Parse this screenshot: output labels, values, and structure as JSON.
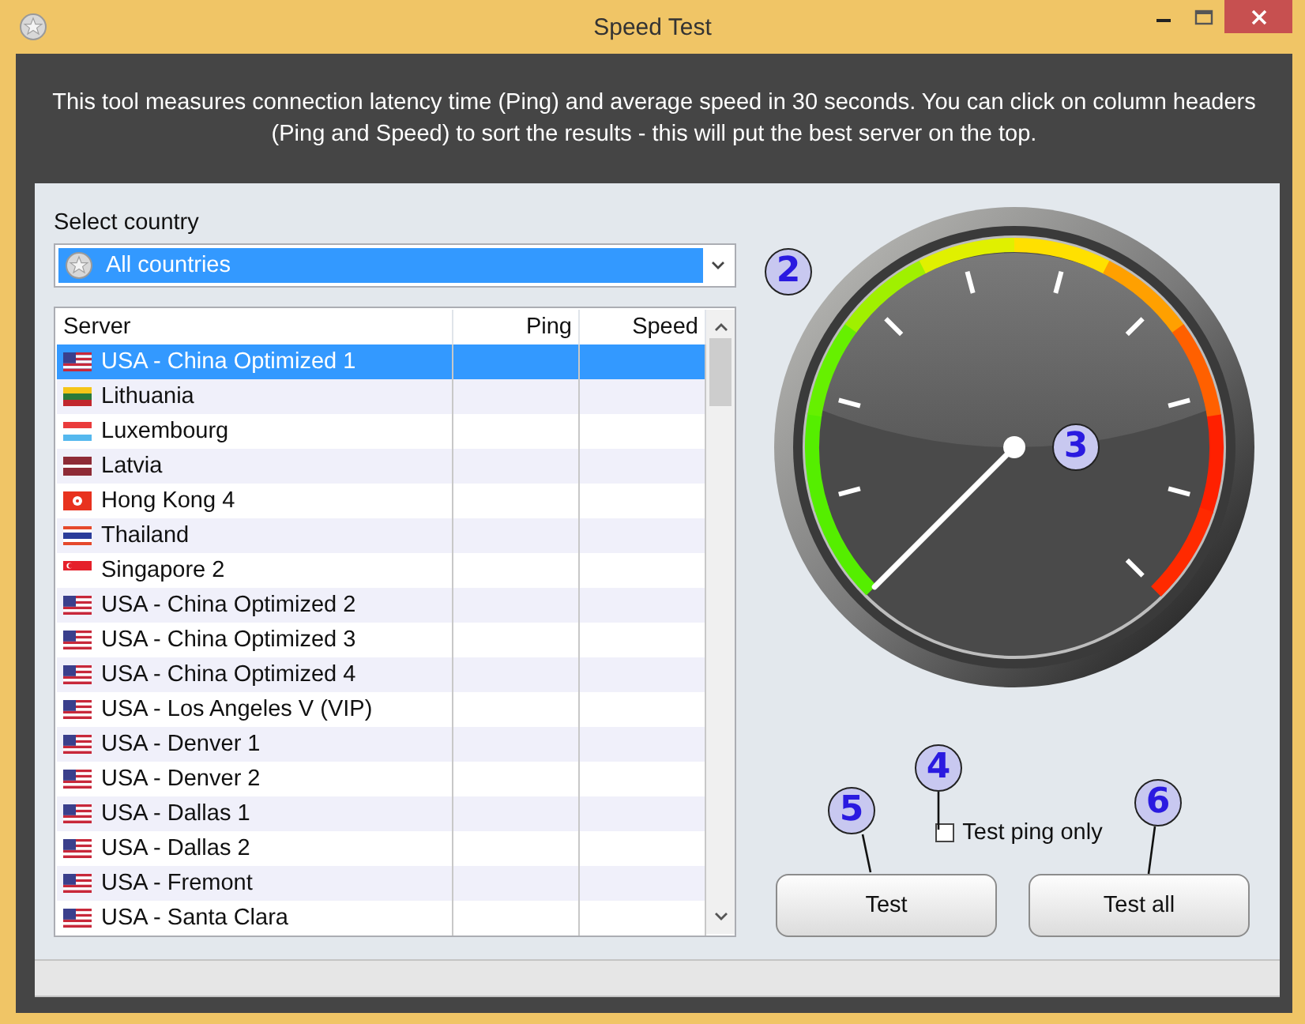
{
  "window": {
    "title": "Speed Test"
  },
  "description": "This tool measures connection latency time (Ping) and average speed in 30 seconds. You can click on column headers (Ping and Speed) to sort the results - this will put the best server on the top.",
  "country_select": {
    "label": "Select country",
    "value": "All countries"
  },
  "server_table": {
    "columns": [
      "Server",
      "Ping",
      "Speed"
    ],
    "rows": [
      {
        "server": "USA - China Optimized 1",
        "kind": "us",
        "selected": true
      },
      {
        "server": "Lithuania",
        "kind": "lt",
        "selected": false
      },
      {
        "server": "Luxembourg",
        "kind": "lu",
        "selected": false
      },
      {
        "server": "Latvia",
        "kind": "lv",
        "selected": false
      },
      {
        "server": "Hong Kong 4",
        "kind": "hk",
        "selected": false
      },
      {
        "server": "Thailand",
        "kind": "th",
        "selected": false
      },
      {
        "server": "Singapore 2",
        "kind": "sg",
        "selected": false
      },
      {
        "server": "USA - China Optimized 2",
        "kind": "us",
        "selected": false
      },
      {
        "server": "USA - China Optimized 3",
        "kind": "us",
        "selected": false
      },
      {
        "server": "USA - China Optimized 4",
        "kind": "us",
        "selected": false
      },
      {
        "server": "USA - Los Angeles V (VIP)",
        "kind": "us",
        "selected": false
      },
      {
        "server": "USA - Denver 1",
        "kind": "us",
        "selected": false
      },
      {
        "server": "USA - Denver 2",
        "kind": "us",
        "selected": false
      },
      {
        "server": "USA - Dallas 1",
        "kind": "us",
        "selected": false
      },
      {
        "server": "USA - Dallas 2",
        "kind": "us",
        "selected": false
      },
      {
        "server": "USA - Fremont",
        "kind": "us",
        "selected": false
      },
      {
        "server": "USA - Santa Clara",
        "kind": "us",
        "selected": false
      }
    ]
  },
  "ping_only": {
    "label": "Test ping only",
    "checked": false
  },
  "buttons": [
    {
      "label": "Test"
    },
    {
      "label": "Test all"
    }
  ],
  "callouts": [
    {
      "label": "2",
      "kind": "gauge"
    },
    {
      "label": "3",
      "kind": "needle"
    },
    {
      "label": "4",
      "kind": "checkbox"
    },
    {
      "label": "5",
      "kind": "test"
    },
    {
      "label": "6",
      "kind": "testall"
    }
  ]
}
